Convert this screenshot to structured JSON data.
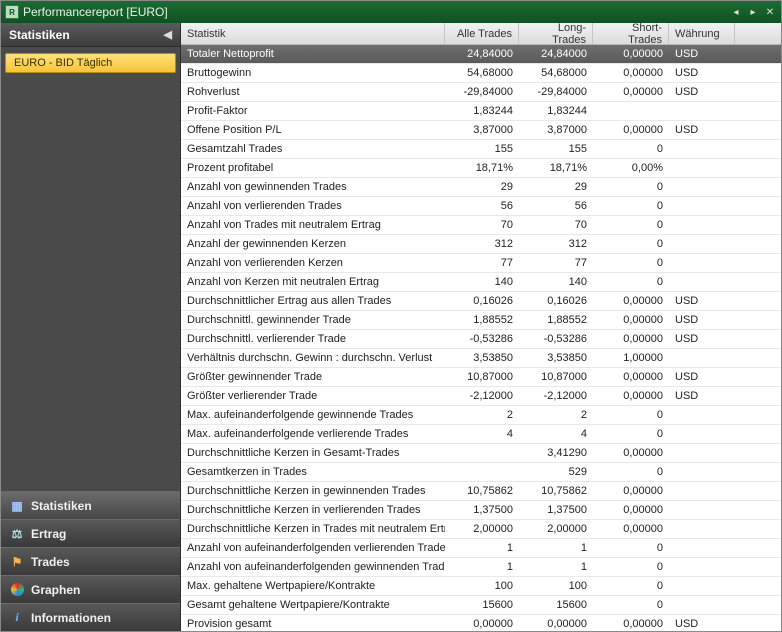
{
  "window": {
    "title": "Performancereport [EURO]"
  },
  "sidebar": {
    "header": "Statistiken",
    "tree": {
      "selected": "EURO - BID Täglich"
    },
    "nav": [
      {
        "key": "statistiken",
        "label": "Statistiken"
      },
      {
        "key": "ertrag",
        "label": "Ertrag"
      },
      {
        "key": "trades",
        "label": "Trades"
      },
      {
        "key": "graphen",
        "label": "Graphen"
      },
      {
        "key": "informationen",
        "label": "Informationen"
      }
    ]
  },
  "table": {
    "columns": {
      "stat": "Statistik",
      "all": "Alle Trades",
      "long": "Long-Trades",
      "short": "Short-Trades",
      "currency": "Währung"
    },
    "rows": [
      {
        "stat": "Totaler Nettoprofit",
        "all": "24,84000",
        "long": "24,84000",
        "short": "0,00000",
        "cur": "USD",
        "selected": true
      },
      {
        "stat": "Bruttogewinn",
        "all": "54,68000",
        "long": "54,68000",
        "short": "0,00000",
        "cur": "USD"
      },
      {
        "stat": "Rohverlust",
        "all": "-29,84000",
        "long": "-29,84000",
        "short": "0,00000",
        "cur": "USD"
      },
      {
        "stat": "Profit-Faktor",
        "all": "1,83244",
        "long": "1,83244",
        "short": "",
        "cur": ""
      },
      {
        "stat": "Offene Position P/L",
        "all": "3,87000",
        "long": "3,87000",
        "short": "0,00000",
        "cur": "USD"
      },
      {
        "stat": "Gesamtzahl Trades",
        "all": "155",
        "long": "155",
        "short": "0",
        "cur": ""
      },
      {
        "stat": "Prozent profitabel",
        "all": "18,71%",
        "long": "18,71%",
        "short": "0,00%",
        "cur": ""
      },
      {
        "stat": "Anzahl von gewinnenden Trades",
        "all": "29",
        "long": "29",
        "short": "0",
        "cur": ""
      },
      {
        "stat": "Anzahl von verlierenden Trades",
        "all": "56",
        "long": "56",
        "short": "0",
        "cur": ""
      },
      {
        "stat": "Anzahl von Trades mit neutralem Ertrag",
        "all": "70",
        "long": "70",
        "short": "0",
        "cur": ""
      },
      {
        "stat": "Anzahl der gewinnenden Kerzen",
        "all": "312",
        "long": "312",
        "short": "0",
        "cur": ""
      },
      {
        "stat": "Anzahl von verlierenden Kerzen",
        "all": "77",
        "long": "77",
        "short": "0",
        "cur": ""
      },
      {
        "stat": "Anzahl von Kerzen mit neutralen Ertrag",
        "all": "140",
        "long": "140",
        "short": "0",
        "cur": ""
      },
      {
        "stat": "Durchschnittlicher Ertrag aus allen Trades",
        "all": "0,16026",
        "long": "0,16026",
        "short": "0,00000",
        "cur": "USD"
      },
      {
        "stat": "Durchschnittl. gewinnender Trade",
        "all": "1,88552",
        "long": "1,88552",
        "short": "0,00000",
        "cur": "USD"
      },
      {
        "stat": "Durchschnittl. verlierender Trade",
        "all": "-0,53286",
        "long": "-0,53286",
        "short": "0,00000",
        "cur": "USD"
      },
      {
        "stat": "Verhältnis durchschn. Gewinn : durchschn. Verlust",
        "all": "3,53850",
        "long": "3,53850",
        "short": "1,00000",
        "cur": ""
      },
      {
        "stat": "Größter gewinnender Trade",
        "all": "10,87000",
        "long": "10,87000",
        "short": "0,00000",
        "cur": "USD"
      },
      {
        "stat": "Größter verlierender Trade",
        "all": "-2,12000",
        "long": "-2,12000",
        "short": "0,00000",
        "cur": "USD"
      },
      {
        "stat": "Max. aufeinanderfolgende gewinnende Trades",
        "all": "2",
        "long": "2",
        "short": "0",
        "cur": ""
      },
      {
        "stat": "Max. aufeinanderfolgende verlierende Trades",
        "all": "4",
        "long": "4",
        "short": "0",
        "cur": ""
      },
      {
        "stat": "Durchschnittliche Kerzen in Gesamt-Trades",
        "all": "",
        "long": "3,41290",
        "short": "0,00000",
        "cur": ""
      },
      {
        "stat": "Gesamtkerzen in Trades",
        "all": "",
        "long": "529",
        "short": "0",
        "cur": ""
      },
      {
        "stat": "Durchschnittliche Kerzen in gewinnenden Trades",
        "all": "10,75862",
        "long": "10,75862",
        "short": "0,00000",
        "cur": ""
      },
      {
        "stat": "Durchschnittliche Kerzen in verlierenden Trades",
        "all": "1,37500",
        "long": "1,37500",
        "short": "0,00000",
        "cur": ""
      },
      {
        "stat": "Durchschnittliche Kerzen in Trades mit neutralem Ertrag",
        "all": "2,00000",
        "long": "2,00000",
        "short": "0,00000",
        "cur": ""
      },
      {
        "stat": "Anzahl von aufeinanderfolgenden verlierenden Trades",
        "all": "1",
        "long": "1",
        "short": "0",
        "cur": ""
      },
      {
        "stat": "Anzahl von aufeinanderfolgenden gewinnenden Trades",
        "all": "1",
        "long": "1",
        "short": "0",
        "cur": ""
      },
      {
        "stat": "Max. gehaltene Wertpapiere/Kontrakte",
        "all": "100",
        "long": "100",
        "short": "0",
        "cur": ""
      },
      {
        "stat": "Gesamt gehaltene Wertpapiere/Kontrakte",
        "all": "15600",
        "long": "15600",
        "short": "0",
        "cur": ""
      },
      {
        "stat": "Provision gesamt",
        "all": "0,00000",
        "long": "0,00000",
        "short": "0,00000",
        "cur": "USD"
      }
    ]
  }
}
